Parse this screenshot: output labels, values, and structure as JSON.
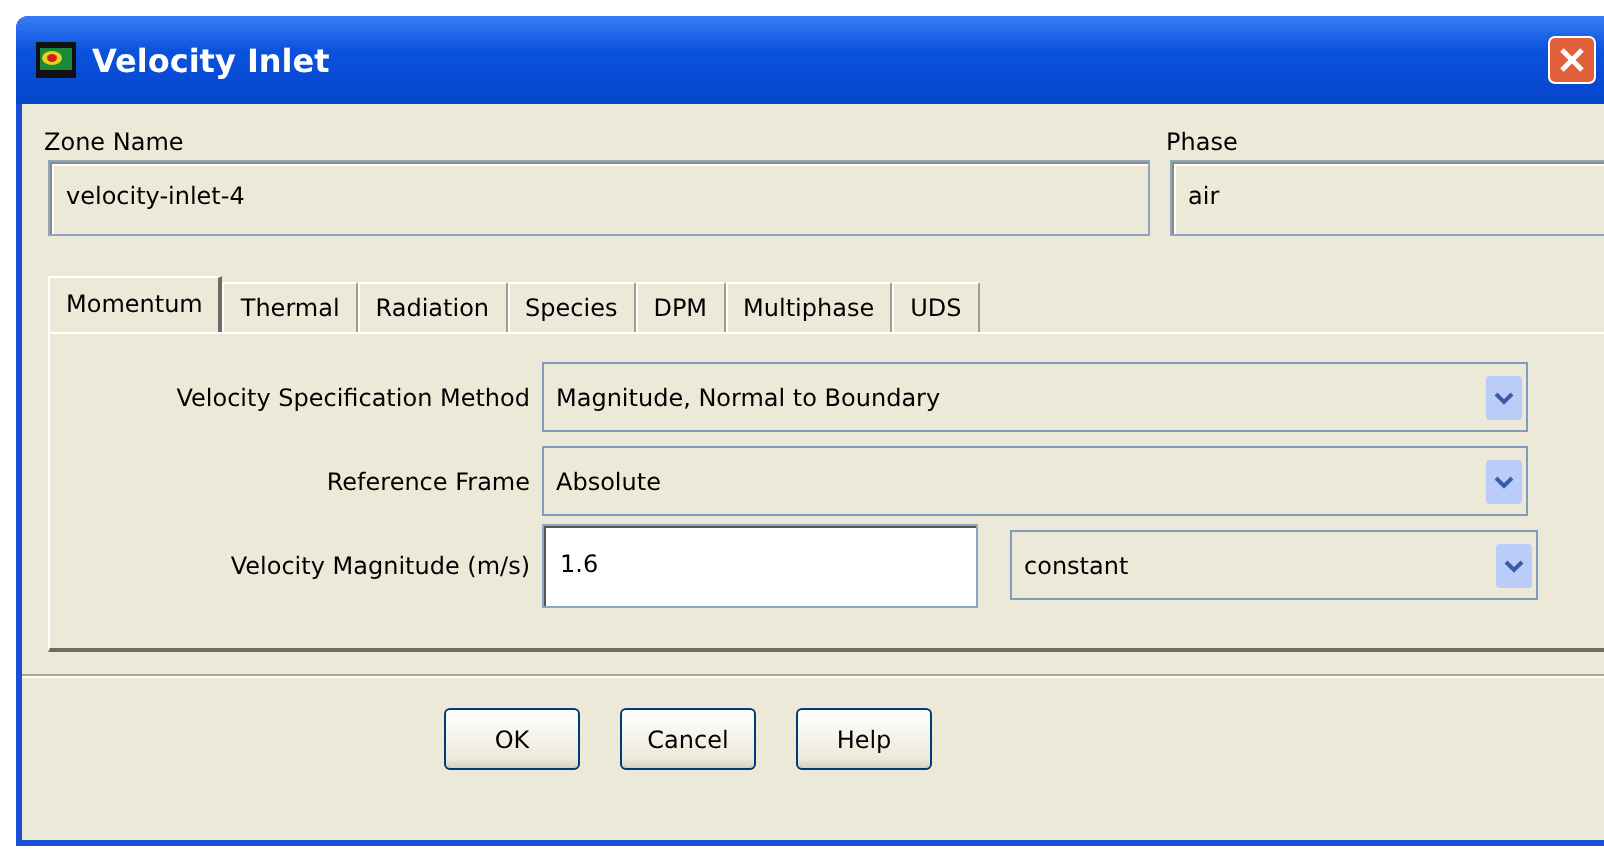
{
  "window": {
    "title": "Velocity Inlet"
  },
  "zone_name": {
    "label": "Zone Name",
    "value": "velocity-inlet-4"
  },
  "phase": {
    "label": "Phase",
    "value": "air"
  },
  "tabs": [
    {
      "label": "Momentum",
      "selected": true
    },
    {
      "label": "Thermal",
      "selected": false
    },
    {
      "label": "Radiation",
      "selected": false
    },
    {
      "label": "Species",
      "selected": false
    },
    {
      "label": "DPM",
      "selected": false
    },
    {
      "label": "Multiphase",
      "selected": false
    },
    {
      "label": "UDS",
      "selected": false
    }
  ],
  "rows": [
    {
      "kind": "combo",
      "label": "Velocity Specification Method",
      "value": "Magnitude, Normal to Boundary"
    },
    {
      "kind": "combo",
      "label": "Reference Frame",
      "value": "Absolute"
    },
    {
      "kind": "input",
      "label": "Velocity Magnitude (m/s)",
      "value": "1.6",
      "profile": "constant"
    }
  ],
  "buttons": [
    "OK",
    "Cancel",
    "Help"
  ]
}
